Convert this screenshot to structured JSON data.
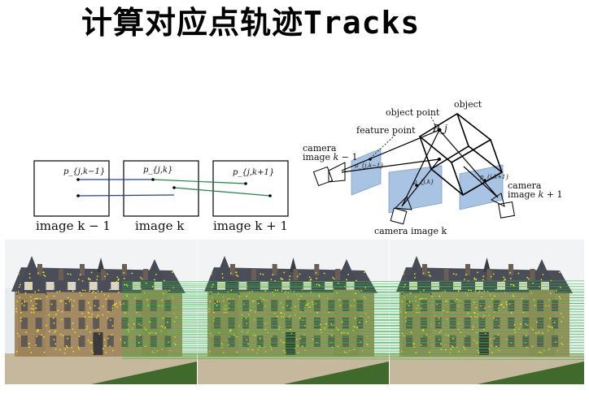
{
  "title": "计算对应点轨迹Tracks",
  "left_diagram": {
    "frames": [
      {
        "label": "image k − 1",
        "point": "p_{j,k−1}"
      },
      {
        "label": "image k",
        "point": "p_{j,k}"
      },
      {
        "label": "image k + 1",
        "point": "p_{j,k+1}"
      }
    ],
    "colors": {
      "blue_track": "#2340a0",
      "green_track": "#1a8a40"
    }
  },
  "right_diagram": {
    "object": "object",
    "object_point": "object point",
    "object_point_symbol": "P_j",
    "feature_point": "feature point",
    "camera_left": "camera image k − 1",
    "camera_middle": "camera image k",
    "camera_right": "camera image k + 1",
    "small_labels": [
      "p_{j,k−1}",
      "p_{j,k}",
      "p_{j,k+1}"
    ],
    "plane_color": "#a9c4e3"
  },
  "photos": {
    "count": 3,
    "description_colors": {
      "feature_point": "#e8e820",
      "track_line": "#2bbd3a",
      "sky": "#e9ecef"
    }
  }
}
